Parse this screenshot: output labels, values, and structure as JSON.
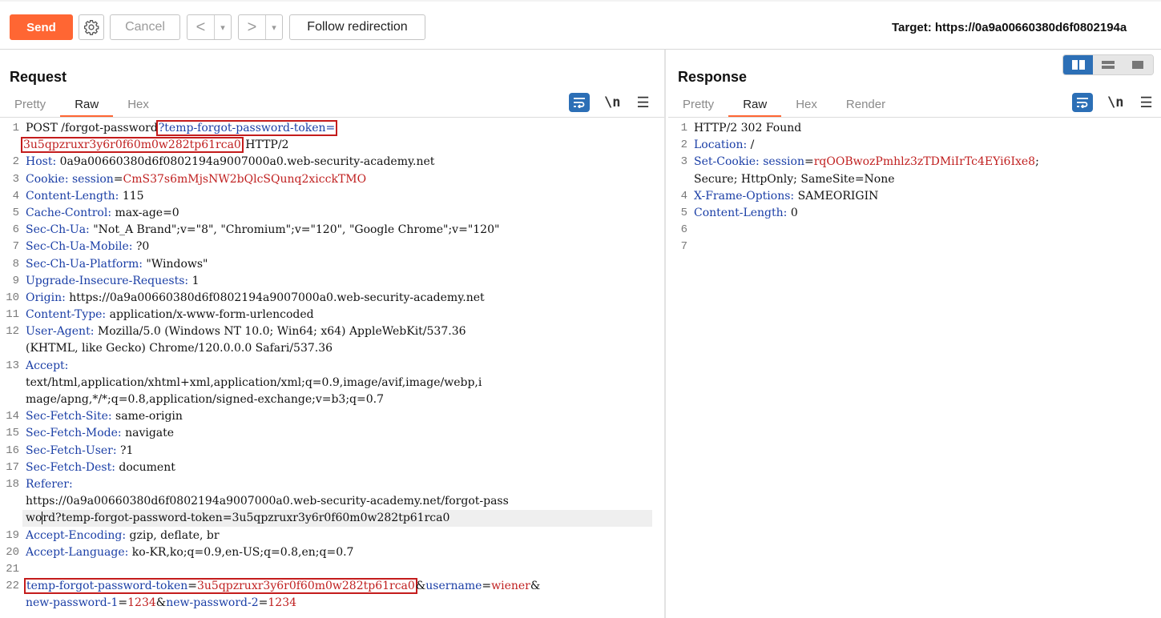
{
  "toolbar": {
    "send": "Send",
    "cancel": "Cancel",
    "back": "<",
    "forward": ">",
    "dropdown": "▾",
    "follow": "Follow redirection",
    "target": "Target: https://0a9a00660380d6f0802194a"
  },
  "request": {
    "title": "Request",
    "tabs": [
      "Pretty",
      "Raw",
      "Hex"
    ],
    "nl": "\\n",
    "lines": {
      "l1a": "POST /forgot-password",
      "l1b": "?temp-forgot-password-token=",
      "l1c": "3u5qpzruxr3y6r0f60m0w282tp61rca0",
      "l1d": " HTTP/2",
      "host_h": "Host:",
      "host_v": " 0a9a00660380d6f0802194a9007000a0.web-security-academy.net",
      "cookie_h": "Cookie:",
      "cookie_n": " session",
      "cookie_eq": "=",
      "cookie_v": "CmS37s6mMjsNW2bQlcSQunq2xicckTMO",
      "cl_h": "Content-Length:",
      "cl_v": " 115",
      "cc_h": "Cache-Control:",
      "cc_v": " max-age=0",
      "ua_h": "Sec-Ch-Ua:",
      "ua_v": " \"Not_A Brand\";v=\"8\", \"Chromium\";v=\"120\", \"Google Chrome\";v=\"120\"",
      "uam_h": "Sec-Ch-Ua-Mobile:",
      "uam_v": " ?0",
      "uap_h": "Sec-Ch-Ua-Platform:",
      "uap_v": " \"Windows\"",
      "uir_h": "Upgrade-Insecure-Requests:",
      "uir_v": " 1",
      "origin_h": "Origin:",
      "origin_v": " https://0a9a00660380d6f0802194a9007000a0.web-security-academy.net",
      "ct_h": "Content-Type:",
      "ct_v": " application/x-www-form-urlencoded",
      "agent_h": "User-Agent:",
      "agent_v1": " Mozilla/5.0 (Windows NT 10.0; Win64; x64) AppleWebKit/537.36",
      "agent_v2": "(KHTML, like Gecko) Chrome/120.0.0.0 Safari/537.36",
      "accept_h": "Accept:",
      "accept_v1": "text/html,application/xhtml+xml,application/xml;q=0.9,image/avif,image/webp,i",
      "accept_v2": "mage/apng,*/*;q=0.8,application/signed-exchange;v=b3;q=0.7",
      "sfs_h": "Sec-Fetch-Site:",
      "sfs_v": " same-origin",
      "sfm_h": "Sec-Fetch-Mode:",
      "sfm_v": " navigate",
      "sfu_h": "Sec-Fetch-User:",
      "sfu_v": " ?1",
      "sfd_h": "Sec-Fetch-Dest:",
      "sfd_v": " document",
      "ref_h": "Referer:",
      "ref_v1": "https://0a9a00660380d6f0802194a9007000a0.web-security-academy.net/forgot-pass",
      "ref_v2a": "wo",
      "ref_v2b": "rd?temp-forgot-password-token=3u5qpzruxr3y6r0f60m0w282tp61rca0",
      "ae_h": "Accept-Encoding:",
      "ae_v": " gzip, deflate, br",
      "al_h": "Accept-Language:",
      "al_v": " ko-KR,ko;q=0.9,en-US;q=0.8,en;q=0.7",
      "b1_n": "temp-forgot-password-token",
      "b1_eq": "=",
      "b1_v": "3u5qpzruxr3y6r0f60m0w282tp61rca0",
      "b1_amp": "&",
      "b1_n2": "username",
      "b1_eq2": "=",
      "b1_v2": "wiener",
      "b1_amp2": "&",
      "b2_n": "new-password-1",
      "b2_eq": "=",
      "b2_v": "1234",
      "b2_amp": "&",
      "b2_n2": "new-password-2",
      "b2_eq2": "=",
      "b2_v2": "1234"
    }
  },
  "response": {
    "title": "Response",
    "tabs": [
      "Pretty",
      "Raw",
      "Hex",
      "Render"
    ],
    "nl": "\\n",
    "lines": {
      "status": "HTTP/2 302 Found",
      "loc_h": "Location:",
      "loc_v": " /",
      "sc_h": "Set-Cookie:",
      "sc_n": " session",
      "sc_eq": "=",
      "sc_v": "rqOOBwozPmhlz3zTDMiIrTc4EYi6Ixe8",
      "sc_semi": ";",
      "sc_v2": "Secure; HttpOnly; SameSite=None",
      "xfo_h": "X-Frame-Options:",
      "xfo_v": " SAMEORIGIN",
      "cl_h": "Content-Length:",
      "cl_v": " 0"
    }
  },
  "line_numbers": [
    "1",
    "2",
    "3",
    "4",
    "5",
    "6",
    "7",
    "8",
    "9",
    "10",
    "11",
    "12",
    "13",
    "14",
    "15",
    "16",
    "17",
    "18",
    "19",
    "20",
    "21",
    "22"
  ],
  "colors": {
    "send": "#ff6633",
    "header_name": "#1a3ea6",
    "param_value": "#c02020",
    "highlight_box": "#c41c1c",
    "active_icon": "#2c6fb6"
  }
}
